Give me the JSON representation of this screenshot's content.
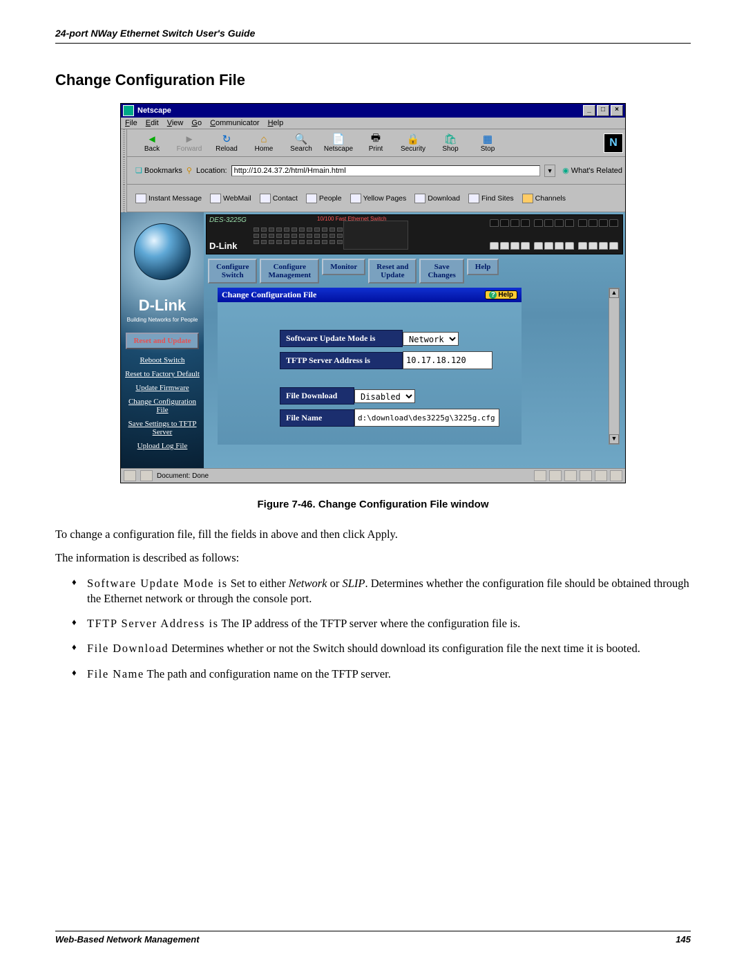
{
  "doc_header": "24-port NWay Ethernet Switch User's Guide",
  "section_title": "Change Configuration File",
  "figure_caption": "Figure 7-46.  Change Configuration File window",
  "para1": "To change a configuration file, fill the fields in above and then click Apply.",
  "para2": "The information is described as follows:",
  "defs": {
    "d1_term": "Software Update Mode is",
    "d1_text_a": "  Set to either ",
    "d1_net": "Network",
    "d1_or": " or ",
    "d1_slip": "SLIP",
    "d1_text_b": ". Determines whether the configuration file should be obtained through the Ethernet network or through the console port.",
    "d2_term": "TFTP Server Address is",
    "d2_text": "  The IP address of the TFTP server where the configuration file is.",
    "d3_term": "File Download",
    "d3_text": "  Determines whether or not the Switch should download its configuration file the next time it is booted.",
    "d4_term": "File Name",
    "d4_text": "  The path and configuration name on the TFTP server."
  },
  "footer_left": "Web-Based Network Management",
  "footer_right": "145",
  "window": {
    "title": "Netscape",
    "menus": {
      "file": "File",
      "edit": "Edit",
      "view": "View",
      "go": "Go",
      "comm": "Communicator",
      "help": "Help"
    },
    "toolbar": {
      "back": "Back",
      "forward": "Forward",
      "reload": "Reload",
      "home": "Home",
      "search": "Search",
      "netscape": "Netscape",
      "print": "Print",
      "security": "Security",
      "shop": "Shop",
      "stop": "Stop"
    },
    "loc": {
      "bookmarks": "Bookmarks",
      "loc_label": "Location:",
      "url": "http://10.24.37.2/html/Hmain.html",
      "related": "What's Related"
    },
    "linkbar": {
      "im": "Instant Message",
      "wm": "WebMail",
      "ct": "Contact",
      "pp": "People",
      "yp": "Yellow Pages",
      "dl": "Download",
      "fs": "Find Sites",
      "ch": "Channels"
    },
    "status": {
      "msg": "Document: Done"
    }
  },
  "app": {
    "brand": "D-Link",
    "brand_sub": "Building Networks for People",
    "device_model": "DES-3225G",
    "device_red": "10/100 Fast Ethernet Switch",
    "side_category": "Reset and Update",
    "side_links": {
      "l1": "Reboot Switch",
      "l2": "Reset to Factory Default",
      "l3": "Update Firmware",
      "l4": "Change Configuration File",
      "l5": "Save Settings to TFTP Server",
      "l6": "Upload Log File"
    },
    "tabs": {
      "t1a": "Configure",
      "t1b": "Switch",
      "t2a": "Configure",
      "t2b": "Management",
      "t3": "Monitor",
      "t4a": "Reset and",
      "t4b": "Update",
      "t5a": "Save",
      "t5b": "Changes",
      "t6": "Help"
    },
    "panel": {
      "title": "Change Configuration File",
      "help": "Help",
      "row1_label": "Software Update Mode is",
      "row1_value": "Network",
      "row2_label": "TFTP Server Address is",
      "row2_value": "10.17.18.120",
      "row3_label": "File Download",
      "row3_value": "Disabled",
      "row4_label": "File Name",
      "row4_value": "d:\\download\\des3225g\\3225g.cfg"
    }
  }
}
